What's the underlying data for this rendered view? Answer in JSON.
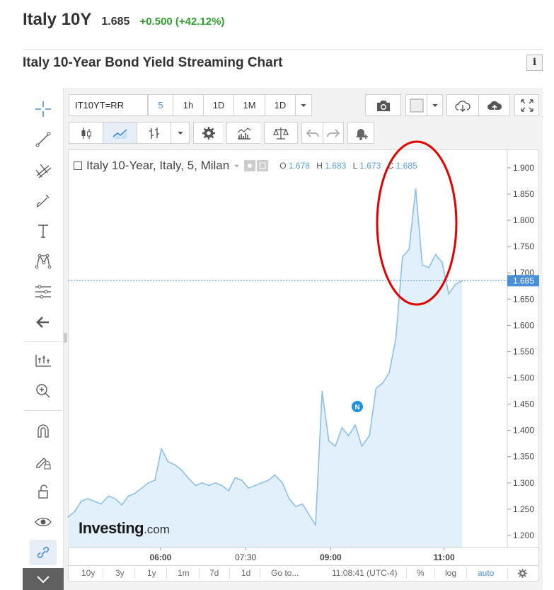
{
  "header": {
    "name": "Italy 10Y",
    "price": "1.685",
    "change": "+0.500 (+42.12%)"
  },
  "section_title": "Italy 10-Year Bond Yield Streaming Chart",
  "info_label": "i",
  "toolbar": {
    "symbol": "IT10YT=RR",
    "intervals": [
      "5",
      "1h",
      "1D",
      "1M",
      "1D"
    ],
    "active_interval": "5"
  },
  "legend": {
    "title": "Italy 10-Year, Italy, 5, Milan",
    "o_label": "O",
    "o_value": "1.678",
    "h_label": "H",
    "h_value": "1.683",
    "l_label": "L",
    "l_value": "1.673",
    "c_label": "C",
    "c_value": "1.685"
  },
  "logo": {
    "main": "Investing",
    "suffix": ".com"
  },
  "news_marker": "N",
  "bottombar": {
    "ranges": [
      "10y",
      "3y",
      "1y",
      "1m",
      "7d",
      "1d"
    ],
    "goto": "Go to...",
    "time": "11:08:41 (UTC-4)",
    "percent": "%",
    "log": "log",
    "auto": "auto"
  },
  "colors": {
    "line": "#8dbfe6",
    "area": "#e2f0fb",
    "accent": "#4a90d9",
    "positive": "#2ea02e",
    "annotation": "#e00000"
  },
  "chart_data": {
    "type": "area",
    "x_ticks": [
      "06:00",
      "07:30",
      "09:00",
      "11:00"
    ],
    "y_ticks": [
      1.9,
      1.85,
      1.8,
      1.75,
      1.7,
      1.65,
      1.6,
      1.55,
      1.5,
      1.45,
      1.4,
      1.35,
      1.3,
      1.25,
      1.2
    ],
    "ylim": [
      1.177,
      1.935
    ],
    "last_value": 1.685,
    "x": [
      "04:22",
      "04:29",
      "04:36",
      "04:43",
      "04:50",
      "04:57",
      "05:05",
      "05:12",
      "05:19",
      "05:26",
      "05:33",
      "05:40",
      "05:47",
      "05:54",
      "06:01",
      "06:08",
      "06:15",
      "06:22",
      "06:29",
      "06:37",
      "06:44",
      "06:51",
      "06:58",
      "07:05",
      "07:12",
      "07:19",
      "07:26",
      "07:33",
      "07:40",
      "07:47",
      "07:54",
      "08:01",
      "08:09",
      "08:16",
      "08:23",
      "08:30",
      "08:37",
      "08:44",
      "08:51",
      "08:58",
      "09:05",
      "09:12",
      "09:19",
      "09:26",
      "09:33",
      "09:41",
      "09:48",
      "09:55",
      "10:02",
      "10:09",
      "10:16",
      "10:23",
      "10:30",
      "10:37",
      "10:44",
      "10:51",
      "10:58",
      "11:05",
      "11:12",
      "11:19"
    ],
    "values": [
      1.235,
      1.245,
      1.265,
      1.27,
      1.265,
      1.26,
      1.275,
      1.27,
      1.258,
      1.275,
      1.28,
      1.29,
      1.3,
      1.305,
      1.365,
      1.34,
      1.335,
      1.325,
      1.31,
      1.295,
      1.3,
      1.295,
      1.3,
      1.295,
      1.285,
      1.31,
      1.305,
      1.29,
      1.295,
      1.3,
      1.305,
      1.315,
      1.3,
      1.27,
      1.255,
      1.26,
      1.24,
      1.22,
      1.475,
      1.38,
      1.37,
      1.405,
      1.39,
      1.41,
      1.37,
      1.39,
      1.48,
      1.49,
      1.51,
      1.575,
      1.73,
      1.745,
      1.86,
      1.715,
      1.71,
      1.735,
      1.72,
      1.66,
      1.678,
      1.685
    ],
    "annotations": [
      {
        "type": "ellipse",
        "around": "peak"
      }
    ]
  }
}
